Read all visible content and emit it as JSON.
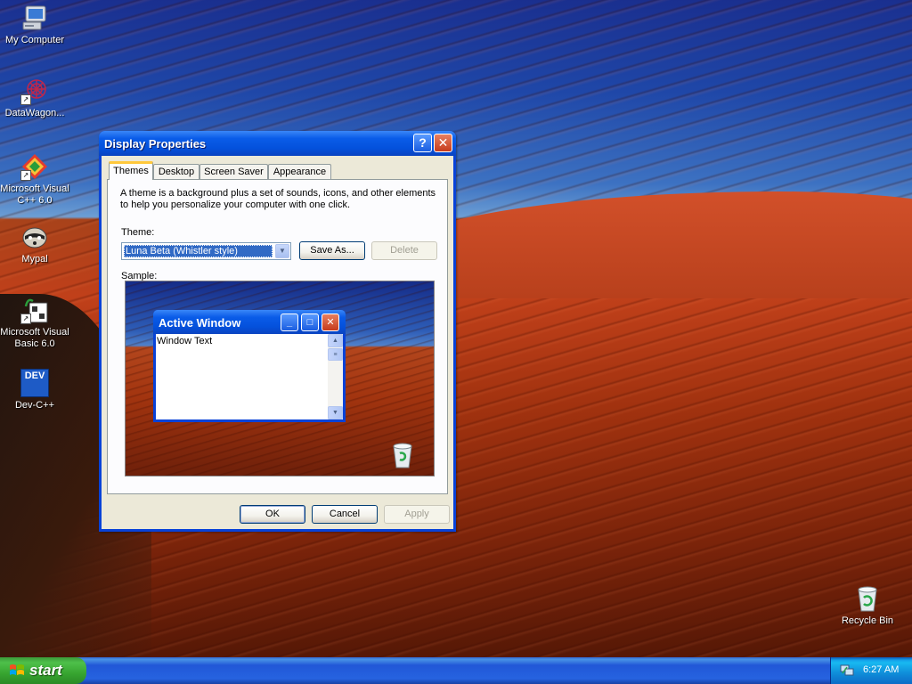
{
  "desktop": {
    "icons": [
      {
        "label": "My Computer"
      },
      {
        "label": "DataWagon..."
      },
      {
        "label": "Microsoft Visual C++ 6.0"
      },
      {
        "label": "Mypal"
      },
      {
        "label": "Microsoft Visual Basic 6.0"
      },
      {
        "label": "Dev-C++"
      },
      {
        "label": "Recycle Bin"
      }
    ],
    "dev_icon_text": "DEV"
  },
  "dialog": {
    "title": "Display Properties",
    "help_glyph": "?",
    "close_glyph": "✕",
    "tabs": [
      {
        "label": "Themes",
        "active": true
      },
      {
        "label": "Desktop",
        "active": false
      },
      {
        "label": "Screen Saver",
        "active": false
      },
      {
        "label": "Appearance",
        "active": false
      }
    ],
    "description": "A theme is a background plus a set of sounds, icons, and other elements to help you personalize your computer with one click.",
    "theme_label": "Theme:",
    "theme_value": "Luna Beta (Whistler style)",
    "save_as_label": "Save As...",
    "delete_label": "Delete",
    "sample_label": "Sample:",
    "sample": {
      "window_title": "Active Window",
      "window_text": "Window Text"
    },
    "ok_label": "OK",
    "cancel_label": "Cancel",
    "apply_label": "Apply"
  },
  "taskbar": {
    "start_label": "start",
    "clock": "6:27 AM"
  },
  "colors": {
    "title_blue": "#0a5ce8",
    "close_red": "#c63b1c",
    "start_green": "#37a530",
    "tab_accent": "#ffc83c"
  }
}
